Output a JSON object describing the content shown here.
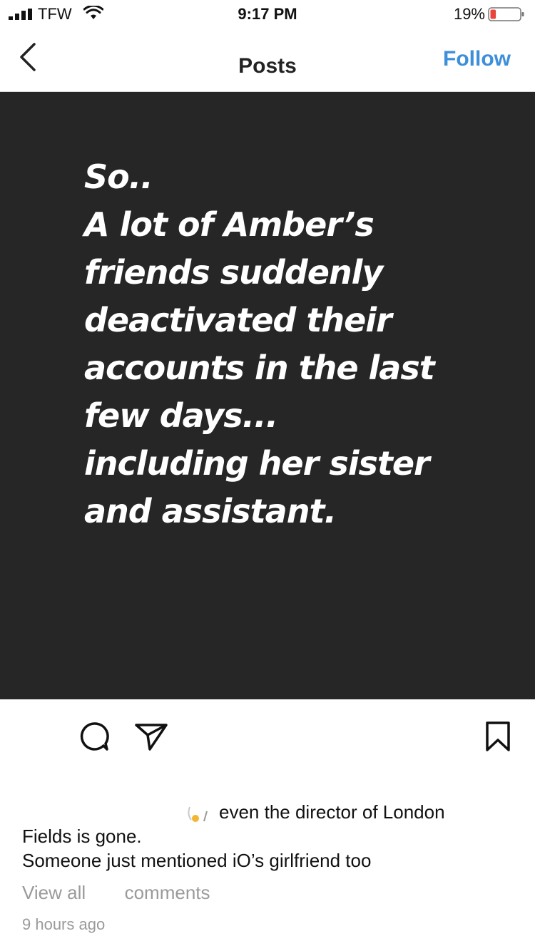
{
  "status_bar": {
    "carrier": "TFW",
    "time": "9:17 PM",
    "battery_percent": "19%",
    "battery_level": 0.19,
    "battery_color": "#e8453c",
    "signal_icon": "signal-bars-icon",
    "wifi_icon": "wifi-icon"
  },
  "nav": {
    "back_icon": "chevron-left-icon",
    "title": "Posts",
    "follow_label": "Follow",
    "accent_color": "#3d8fdb"
  },
  "post": {
    "image_background": "#262626",
    "image_text_lines": [
      "So..",
      "A lot of Amber’s",
      "friends suddenly",
      "deactivated their",
      "accounts in the last",
      "few days...",
      "including her sister",
      "and assistant."
    ],
    "actions": {
      "comment_icon": "comment-bubble-icon",
      "share_icon": "paper-plane-icon",
      "save_icon": "bookmark-icon"
    },
    "caption_lines": [
      "even the director of London",
      "Fields is gone.",
      "Someone just mentioned iO’s girlfriend too"
    ],
    "view_comments_label": "View all",
    "view_comments_suffix": "comments",
    "timestamp": "9 hours ago"
  }
}
